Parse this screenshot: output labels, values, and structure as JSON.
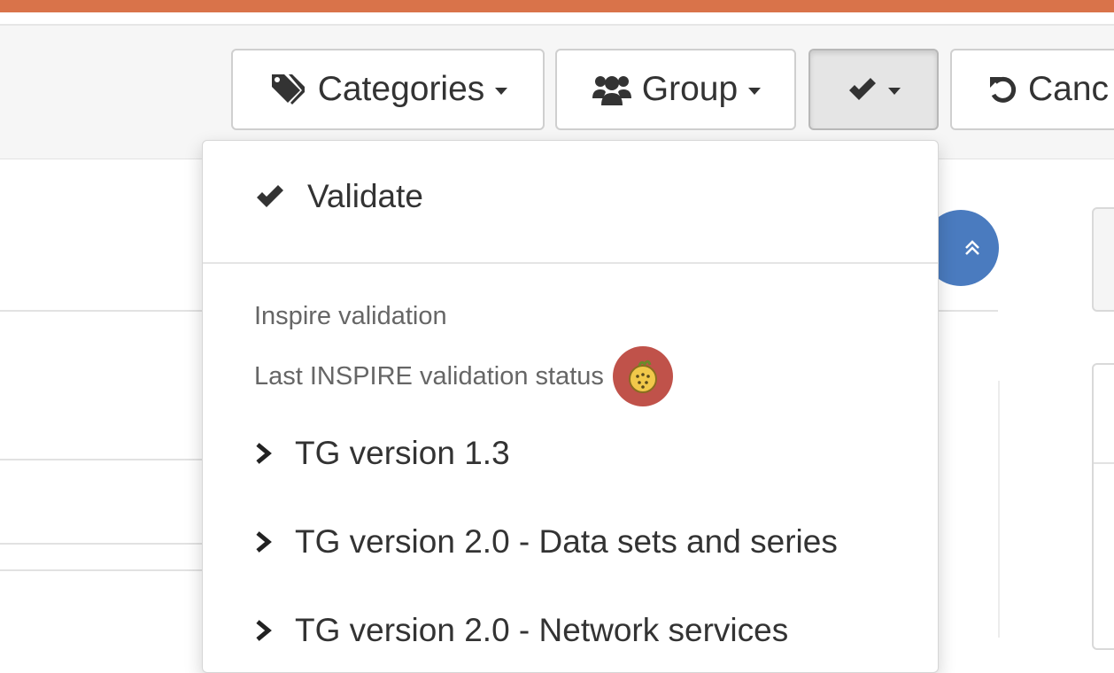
{
  "toolbar": {
    "categories_label": "Categories",
    "group_label": "Group",
    "cancel_label": "Canc"
  },
  "dropdown": {
    "validate_label": "Validate",
    "section_header": "Inspire validation",
    "status_label": "Last INSPIRE validation status",
    "items": [
      {
        "label": "TG version 1.3"
      },
      {
        "label": "TG version 2.0 - Data sets and series"
      },
      {
        "label": "TG version 2.0 - Network services"
      }
    ]
  },
  "colors": {
    "accent_bar": "#d9734a",
    "scroll_button": "#4a7bbf",
    "status_badge": "#c0524a"
  },
  "icons": {
    "categories": "tags-icon",
    "group": "users-icon",
    "validate": "check-icon",
    "cancel": "undo-icon",
    "scroll_top": "double-chevron-up-icon",
    "status": "status-indicator-icon",
    "item": "chevron-right-icon"
  }
}
